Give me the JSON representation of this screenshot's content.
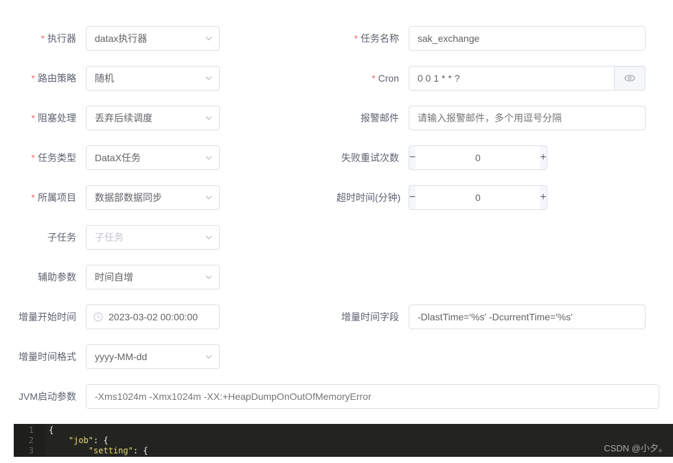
{
  "labels": {
    "executor": "执行器",
    "task_name": "任务名称",
    "route_strategy": "路由策略",
    "cron": "Cron",
    "block_strategy": "阻塞处理",
    "alert_email": "报警邮件",
    "task_type": "任务类型",
    "retry_count": "失败重试次数",
    "project": "所属项目",
    "timeout": "超时时间(分钟)",
    "subtask": "子任务",
    "aux_param": "辅助参数",
    "inc_start": "增量开始时间",
    "inc_field": "增量时间字段",
    "inc_format": "增量时间格式",
    "jvm_param": "JVM启动参数"
  },
  "values": {
    "executor": "datax执行器",
    "task_name": "sak_exchange",
    "route_strategy": "随机",
    "cron": "0 0 1 * * ?",
    "block_strategy": "丢弃后续调度",
    "task_type": "DataX任务",
    "retry_count": "0",
    "project": "数据部数据同步",
    "timeout": "0",
    "aux_param": "时间自增",
    "inc_start": "2023-03-02 00:00:00",
    "inc_field": "-DlastTime='%s' -DcurrentTime='%s'",
    "inc_format": "yyyy-MM-dd"
  },
  "placeholders": {
    "alert_email": "请输入报警邮件，多个用逗号分隔",
    "subtask": "子任务",
    "jvm_param": "-Xms1024m -Xmx1024m -XX:+HeapDumpOnOutOfMemoryError"
  },
  "buttons": {
    "minus": "−",
    "plus": "+"
  },
  "code": {
    "lines": [
      "1",
      "2",
      "3"
    ],
    "l1": "{",
    "l2_key": "\"job\"",
    "l2_rest": ": {",
    "l3_indent": "        ",
    "l3_key": "\"setting\"",
    "l3_rest": ": {"
  },
  "watermark": "CSDN @小夕。"
}
